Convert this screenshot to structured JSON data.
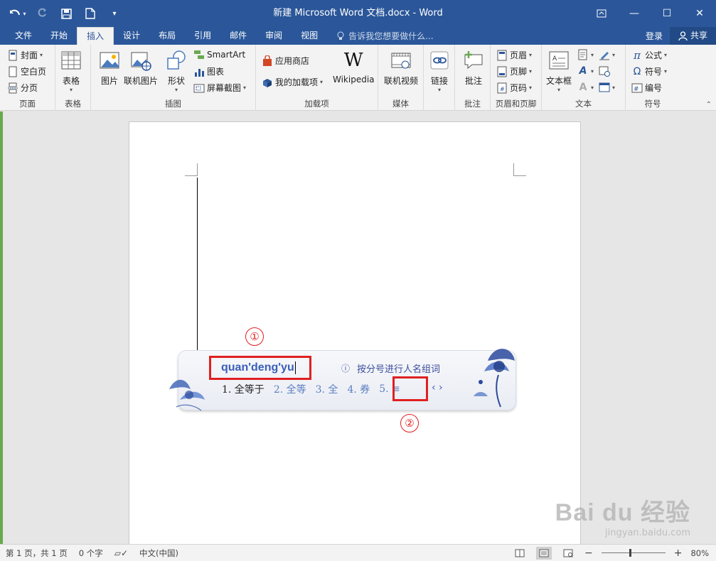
{
  "titlebar": {
    "title": "新建 Microsoft Word 文档.docx - Word",
    "minimize": "—",
    "maximize": "☐",
    "close": "✕",
    "ribbon_display": "⧉"
  },
  "tabs": [
    {
      "label": "文件"
    },
    {
      "label": "开始"
    },
    {
      "label": "插入",
      "active": true
    },
    {
      "label": "设计"
    },
    {
      "label": "布局"
    },
    {
      "label": "引用"
    },
    {
      "label": "邮件"
    },
    {
      "label": "审阅"
    },
    {
      "label": "视图"
    }
  ],
  "tell_me": "告诉我您想要做什么...",
  "login": "登录",
  "share": "共享",
  "ribbon": {
    "pages": {
      "label": "页面",
      "cover": "封面",
      "blank": "空白页",
      "break": "分页"
    },
    "tables": {
      "label": "表格",
      "table": "表格"
    },
    "illustrations": {
      "label": "插图",
      "picture": "图片",
      "online_picture": "联机图片",
      "shapes": "形状",
      "smartart": "SmartArt",
      "chart": "图表",
      "screenshot": "屏幕截图"
    },
    "addins": {
      "label": "加载项",
      "store": "应用商店",
      "my_addins": "我的加载项",
      "wikipedia": "Wikipedia"
    },
    "media": {
      "label": "媒体",
      "online_video": "联机视频"
    },
    "links": {
      "link": "链接"
    },
    "comments": {
      "label": "批注",
      "comment": "批注"
    },
    "header_footer": {
      "label": "页眉和页脚",
      "header": "页眉",
      "footer": "页脚",
      "page_number": "页码"
    },
    "text": {
      "label": "文本",
      "textbox": "文本框"
    },
    "symbols": {
      "label": "符号",
      "equation": "公式",
      "symbol": "符号",
      "numbering": "编号"
    }
  },
  "ime": {
    "input": "quan'deng'yu",
    "hint": "按分号进行人名组词",
    "candidates": [
      "1. 全等于",
      "2. 全等",
      "3. 全",
      "4. 券",
      "5. ≡"
    ],
    "pager": "‹ ›",
    "marker1": "①",
    "marker2": "②"
  },
  "watermark": {
    "main": "Bai du 经验",
    "url": "jingyan.baidu.com"
  },
  "status": {
    "page": "第 1 页，共 1 页",
    "words": "0 个字",
    "language": "中文(中国)",
    "zoom_minus": "−",
    "zoom_plus": "+",
    "zoom": "80%",
    "zoom_level": 0.45
  },
  "colors": {
    "accent": "#2b579a",
    "highlight": "#e02020",
    "ime_text": "#3b5eb8"
  }
}
